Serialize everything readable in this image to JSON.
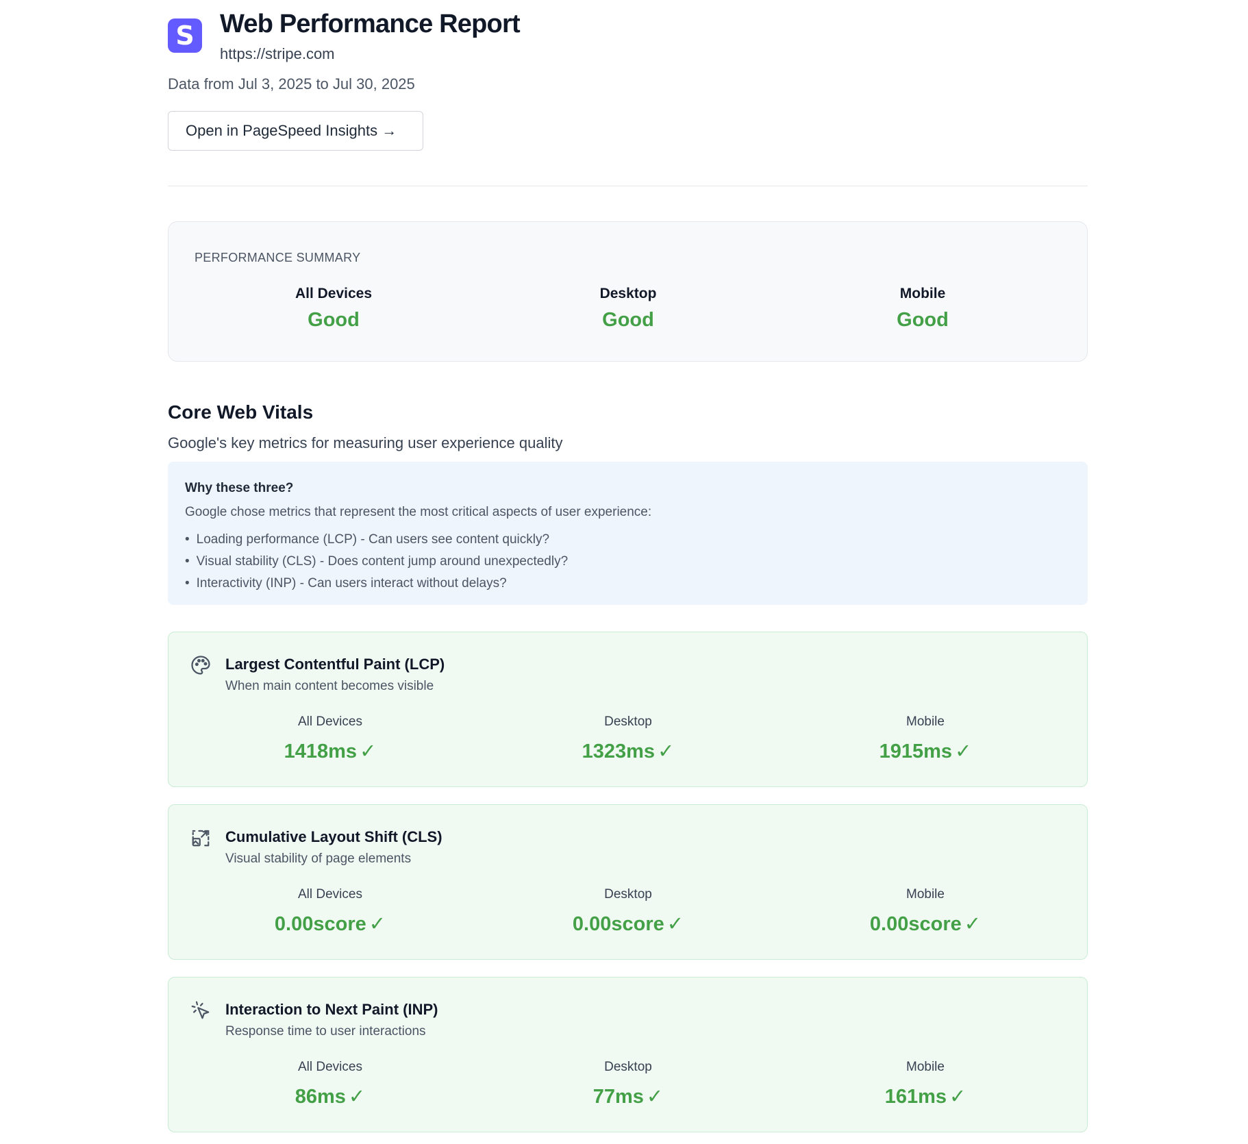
{
  "header": {
    "logo_letter": "S",
    "title": "Web Performance Report",
    "url": "https://stripe.com",
    "date_range": "Data from Jul 3, 2025 to Jul 30, 2025",
    "psi_button": "Open in PageSpeed Insights →"
  },
  "summary": {
    "label": "PERFORMANCE SUMMARY",
    "columns": [
      {
        "device": "All Devices",
        "value": "Good"
      },
      {
        "device": "Desktop",
        "value": "Good"
      },
      {
        "device": "Mobile",
        "value": "Good"
      }
    ]
  },
  "cwv": {
    "title": "Core Web Vitals",
    "subtitle": "Google's key metrics for measuring user experience quality",
    "why": {
      "title": "Why these three?",
      "desc": "Google chose metrics that represent the most critical aspects of user experience:",
      "items": [
        "Loading performance (LCP) - Can users see content quickly?",
        "Visual stability (CLS) - Does content jump around unexpectedly?",
        "Interactivity (INP) - Can users interact without delays?"
      ]
    }
  },
  "metrics": [
    {
      "icon": "palette-icon",
      "title": "Largest Contentful Paint (LCP)",
      "desc": "When main content becomes visible",
      "columns": [
        {
          "device": "All Devices",
          "value": "1418ms"
        },
        {
          "device": "Desktop",
          "value": "1323ms"
        },
        {
          "device": "Mobile",
          "value": "1915ms"
        }
      ]
    },
    {
      "icon": "layout-shift-icon",
      "title": "Cumulative Layout Shift (CLS)",
      "desc": "Visual stability of page elements",
      "columns": [
        {
          "device": "All Devices",
          "value": "0.00score"
        },
        {
          "device": "Desktop",
          "value": "0.00score"
        },
        {
          "device": "Mobile",
          "value": "0.00score"
        }
      ]
    },
    {
      "icon": "pointer-click-icon",
      "title": "Interaction to Next Paint (INP)",
      "desc": "Response time to user interactions",
      "columns": [
        {
          "device": "All Devices",
          "value": "86ms"
        },
        {
          "device": "Desktop",
          "value": "77ms"
        },
        {
          "device": "Mobile",
          "value": "161ms"
        }
      ]
    }
  ],
  "colors": {
    "good": "#43a047",
    "brand": "#635bff",
    "metric_bg": "#f0faf3",
    "info_bg": "#eef5fd"
  },
  "check_glyph": "✓"
}
